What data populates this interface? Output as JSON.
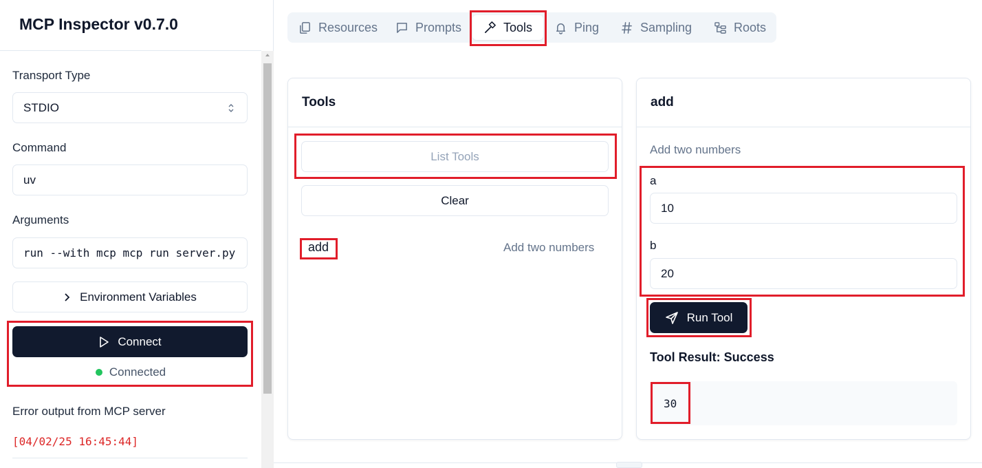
{
  "app": {
    "title": "MCP Inspector v0.7.0"
  },
  "sidebar": {
    "transport_label": "Transport Type",
    "transport_value": "STDIO",
    "command_label": "Command",
    "command_value": "uv",
    "arguments_label": "Arguments",
    "arguments_value": "run --with mcp mcp run server.py",
    "env_label": "Environment Variables",
    "connect_label": "Connect",
    "status_text": "Connected",
    "error_label": "Error output from MCP server",
    "error_line": "[04/02/25 16:45:44]"
  },
  "tabs": [
    {
      "label": "Resources",
      "icon": "files-icon"
    },
    {
      "label": "Prompts",
      "icon": "message-square-icon"
    },
    {
      "label": "Tools",
      "icon": "hammer-icon",
      "active": true
    },
    {
      "label": "Ping",
      "icon": "bell-icon"
    },
    {
      "label": "Sampling",
      "icon": "hash-icon"
    },
    {
      "label": "Roots",
      "icon": "folder-tree-icon"
    }
  ],
  "tools_panel": {
    "title": "Tools",
    "list_label": "List Tools",
    "clear_label": "Clear",
    "items": [
      {
        "name": "add",
        "description": "Add two numbers"
      }
    ]
  },
  "tool_detail": {
    "title": "add",
    "description": "Add two numbers",
    "params": [
      {
        "name": "a",
        "value": "10"
      },
      {
        "name": "b",
        "value": "20"
      }
    ],
    "run_label": "Run Tool",
    "result_title": "Tool Result: Success",
    "result_value": "30"
  },
  "colors": {
    "primary_button": "#111a2e",
    "status_connected": "#22c55e",
    "error_text": "#dc2626",
    "highlight": "#e11d2a"
  }
}
